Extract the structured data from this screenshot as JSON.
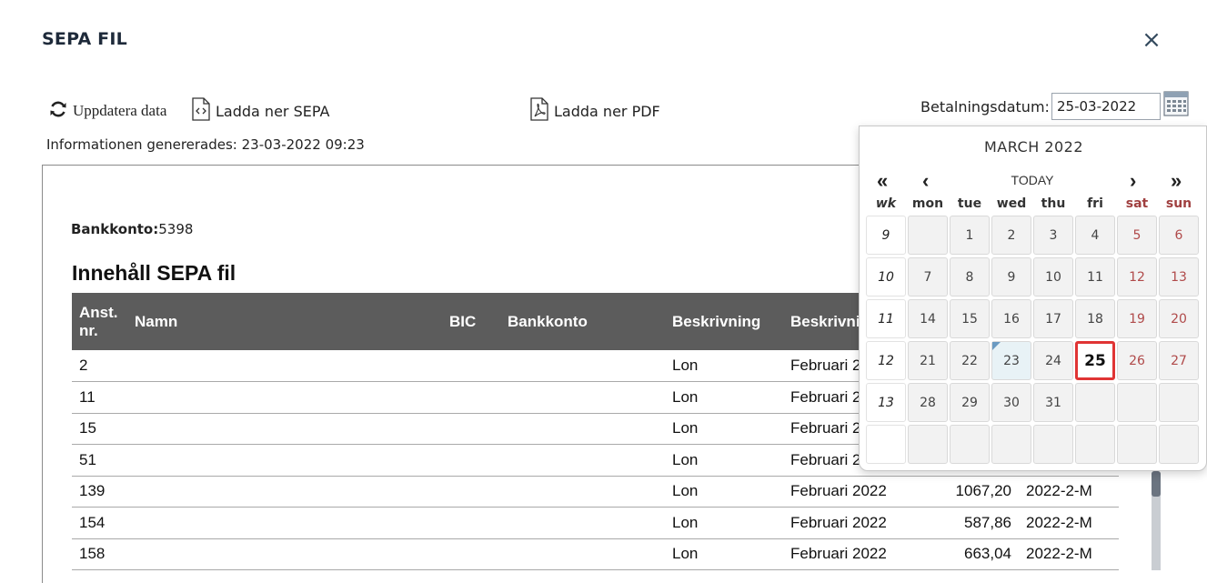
{
  "dialog": {
    "title": "SEPA FIL",
    "close_glyph": "×"
  },
  "toolbar": {
    "refresh_label": "Uppdatera data",
    "download_sepa_label": "Ladda ner SEPA",
    "download_pdf_label": "Ladda ner PDF",
    "date_label": "Betalningsdatum:",
    "date_value": "25-03-2022",
    "icons": {
      "refresh": "refresh-icon",
      "sepa": "code-file-icon",
      "pdf": "pdf-file-icon",
      "calendar": "calendar-icon"
    }
  },
  "info": {
    "generated_text": "Informationen genererades: 23-03-2022 09:23"
  },
  "report": {
    "bank_label": "Bankkonto:",
    "bank_value": "5398",
    "section_title": "Innehåll SEPA fil",
    "columns": [
      "Anst. nr.",
      "Namn",
      "BIC",
      "Bankkonto",
      "Beskrivning",
      "Beskrivning",
      "",
      ""
    ],
    "rows": [
      {
        "anst": "2",
        "namn": "",
        "bic": "",
        "konto": "",
        "beskr": "Lon",
        "beskr2": "Februari 2022",
        "belopp": "",
        "ref": ""
      },
      {
        "anst": "11",
        "namn": "",
        "bic": "",
        "konto": "",
        "beskr": "Lon",
        "beskr2": "Februari 2022",
        "belopp": "",
        "ref": ""
      },
      {
        "anst": "15",
        "namn": "",
        "bic": "",
        "konto": "",
        "beskr": "Lon",
        "beskr2": "Februari 2022",
        "belopp": "",
        "ref": ""
      },
      {
        "anst": "51",
        "namn": "",
        "bic": "",
        "konto": "",
        "beskr": "Lon",
        "beskr2": "Februari 2022",
        "belopp": "",
        "ref": ""
      },
      {
        "anst": "139",
        "namn": "",
        "bic": "",
        "konto": "",
        "beskr": "Lon",
        "beskr2": "Februari 2022",
        "belopp": "1067,20",
        "ref": "2022-2-M"
      },
      {
        "anst": "154",
        "namn": "",
        "bic": "",
        "konto": "",
        "beskr": "Lon",
        "beskr2": "Februari 2022",
        "belopp": "587,86",
        "ref": "2022-2-M"
      },
      {
        "anst": "158",
        "namn": "",
        "bic": "",
        "konto": "",
        "beskr": "Lon",
        "beskr2": "Februari 2022",
        "belopp": "663,04",
        "ref": "2022-2-M"
      }
    ]
  },
  "calendar": {
    "month_label": "MARCH 2022",
    "today_label": "TODAY",
    "nav": {
      "prev_year": "«",
      "prev_month": "‹",
      "next_month": "›",
      "next_year": "»"
    },
    "weekday_headers": [
      "wk",
      "mon",
      "tue",
      "wed",
      "thu",
      "fri",
      "sat",
      "sun"
    ],
    "weeks": [
      {
        "wk": "9",
        "days": [
          "",
          "1",
          "2",
          "3",
          "4",
          "5",
          "6"
        ]
      },
      {
        "wk": "10",
        "days": [
          "7",
          "8",
          "9",
          "10",
          "11",
          "12",
          "13"
        ]
      },
      {
        "wk": "11",
        "days": [
          "14",
          "15",
          "16",
          "17",
          "18",
          "19",
          "20"
        ]
      },
      {
        "wk": "12",
        "days": [
          "21",
          "22",
          "23",
          "24",
          "25",
          "26",
          "27"
        ]
      },
      {
        "wk": "13",
        "days": [
          "28",
          "29",
          "30",
          "31",
          "",
          "",
          ""
        ]
      },
      {
        "wk": "",
        "days": [
          "",
          "",
          "",
          "",
          "",
          "",
          ""
        ]
      }
    ],
    "today_day": "23",
    "selected_day": "25",
    "colors": {
      "weekend": "#b04a4a",
      "selected_border": "#e03434",
      "today_marker": "#6a9ac2"
    }
  }
}
